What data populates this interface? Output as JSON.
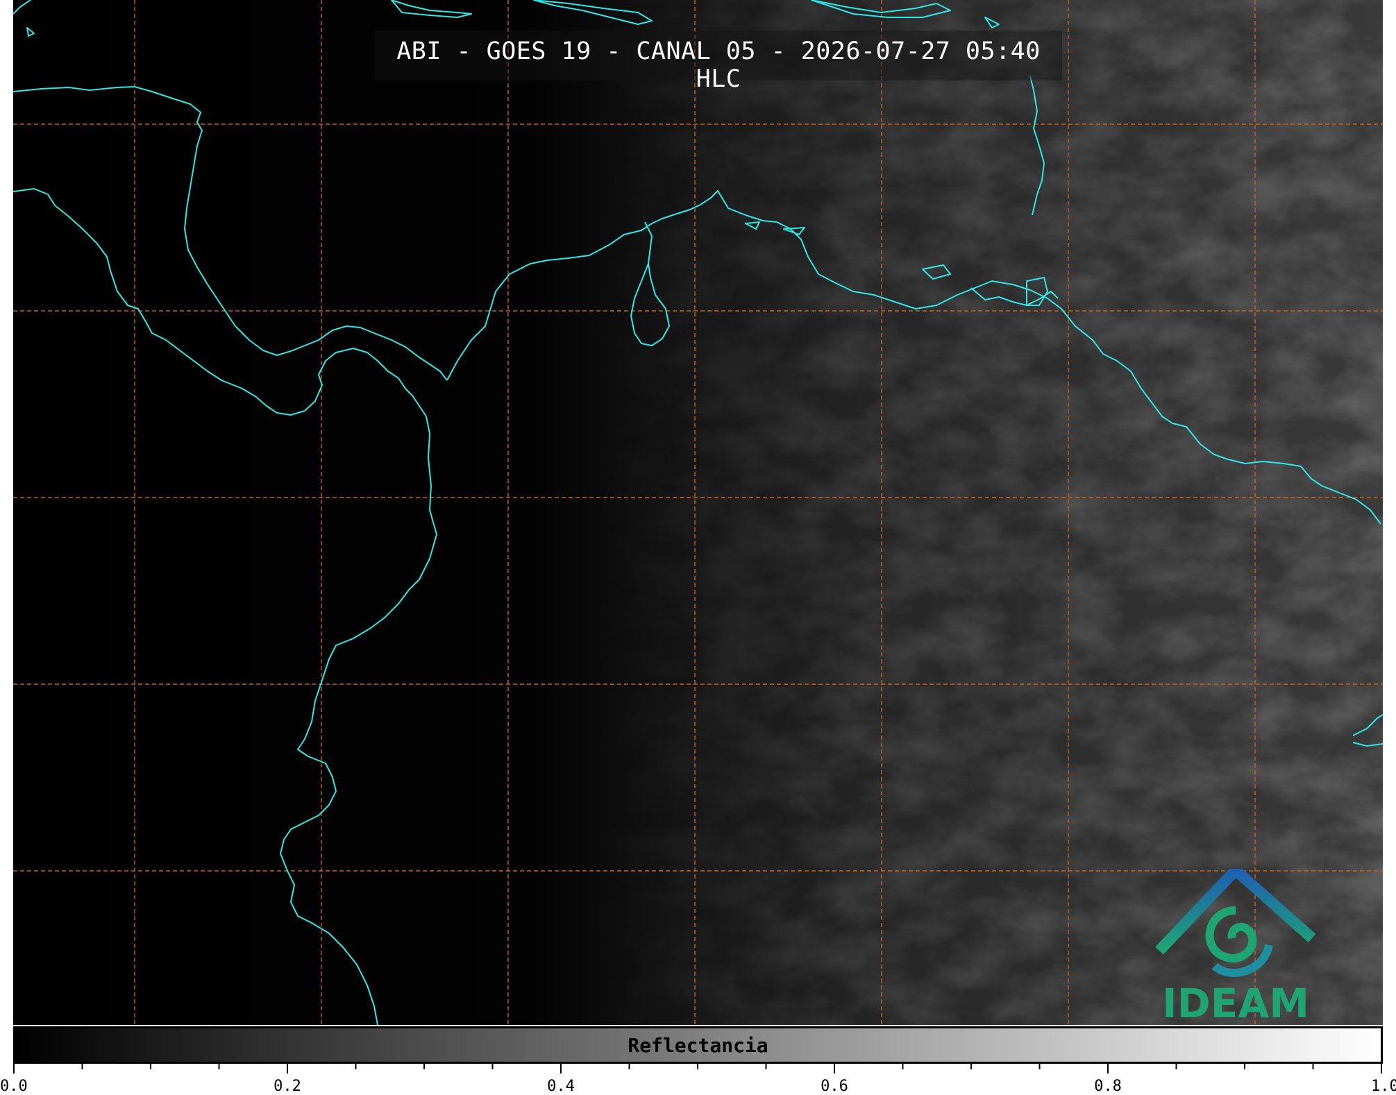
{
  "title": "ABI - GOES 19 - CANAL 05 - 2026-07-27 05:40 HLC",
  "logo": {
    "text": "IDEAM"
  },
  "colorbar": {
    "label": "Reflectancia",
    "min": 0.0,
    "max": 1.0,
    "tick_labels": [
      "0.0",
      "0.2",
      "0.4",
      "0.6",
      "0.8",
      "1.0"
    ],
    "colormap_start": "#000000",
    "colormap_end": "#ffffff"
  },
  "colors": {
    "coastline": "#2ee8e8",
    "gridline": "#c8641e",
    "logo_green": "#1fa574",
    "logo_blue": "#1e6fb4"
  }
}
